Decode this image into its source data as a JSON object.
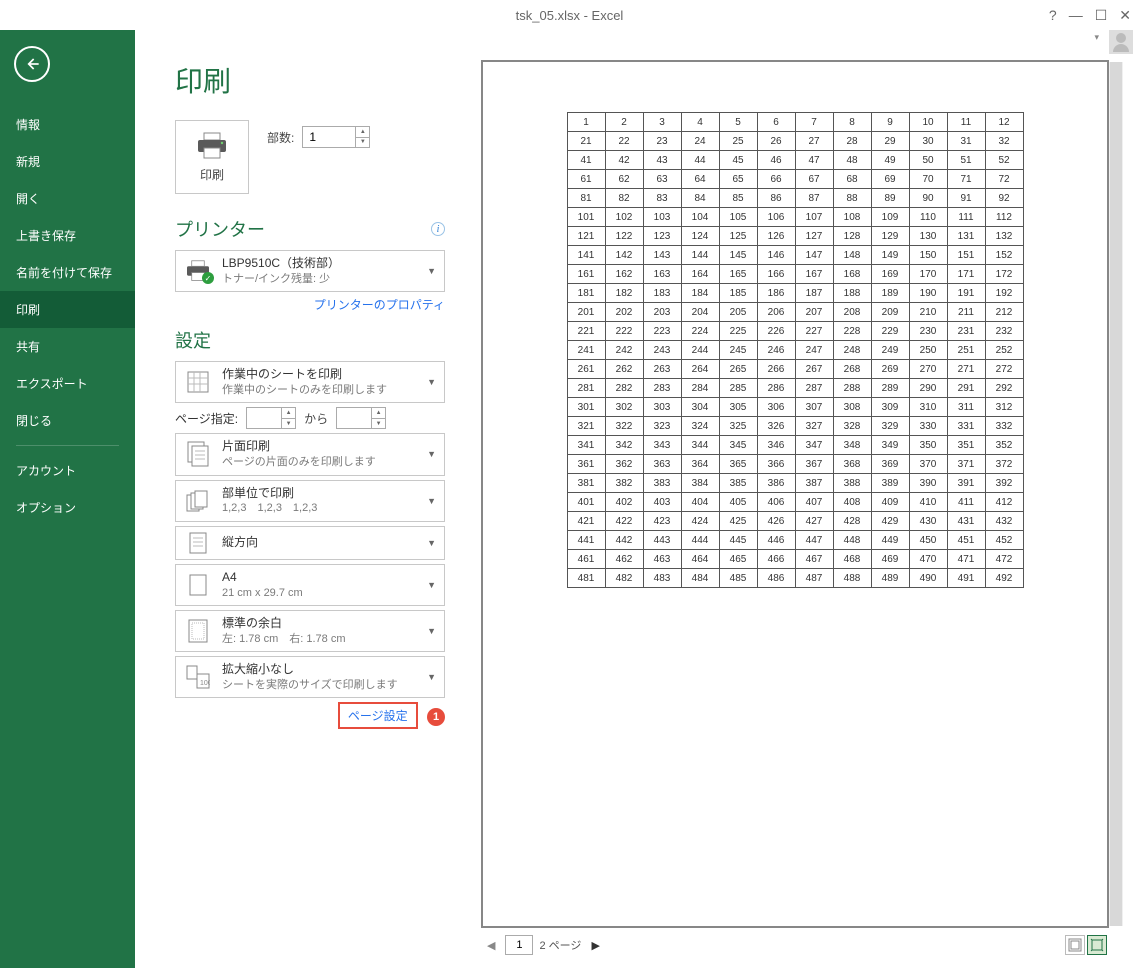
{
  "titlebar": {
    "title": "tsk_05.xlsx - Excel",
    "help": "?",
    "minimize": "—",
    "maximize": "☐",
    "close": "✕"
  },
  "sidebar": {
    "items": [
      {
        "label": "情報"
      },
      {
        "label": "新規"
      },
      {
        "label": "開く"
      },
      {
        "label": "上書き保存"
      },
      {
        "label": "名前を付けて保存"
      },
      {
        "label": "印刷",
        "active": true
      },
      {
        "label": "共有"
      },
      {
        "label": "エクスポート"
      },
      {
        "label": "閉じる"
      }
    ],
    "items2": [
      {
        "label": "アカウント"
      },
      {
        "label": "オプション"
      }
    ]
  },
  "print": {
    "page_title": "印刷",
    "print_btn": "印刷",
    "copies_label": "部数:",
    "copies_value": "1",
    "printer_header": "プリンター",
    "printer_name": "LBP9510C（技術部）",
    "printer_status": "トナー/インク残量: 少",
    "printer_props": "プリンターのプロパティ",
    "settings_header": "設定",
    "opt_sheets_title": "作業中のシートを印刷",
    "opt_sheets_sub": "作業中のシートのみを印刷します",
    "page_range_label": "ページ指定:",
    "page_range_from": "",
    "page_range_to_label": "から",
    "page_range_to": "",
    "opt_oneside_title": "片面印刷",
    "opt_oneside_sub": "ページの片面のみを印刷します",
    "opt_collate_title": "部単位で印刷",
    "opt_collate_sub": "1,2,3　1,2,3　1,2,3",
    "opt_orientation": "縦方向",
    "opt_paper_title": "A4",
    "opt_paper_sub": "21 cm x 29.7 cm",
    "opt_margins_title": "標準の余白",
    "opt_margins_sub": "左:  1.78 cm　右:  1.78 cm",
    "opt_scale_title": "拡大縮小なし",
    "opt_scale_sub": "シートを実際のサイズで印刷します",
    "page_setup_link": "ページ設定",
    "annotation_num": "1"
  },
  "preview": {
    "pager_current": "1",
    "pager_total": "2 ページ",
    "nav_prev": "◀",
    "nav_next": "▶"
  },
  "chart_data": {
    "type": "table",
    "title": "Print preview grid",
    "rows": 25,
    "cols": 12,
    "first_value": 1,
    "row_stride": 20,
    "note": "Cell value = first_value + rowIndex*row_stride + colIndex; rows 0..24, cols 0..11; displayed values 1..492 (each row shows first 12 of 20 consecutive integers)."
  }
}
